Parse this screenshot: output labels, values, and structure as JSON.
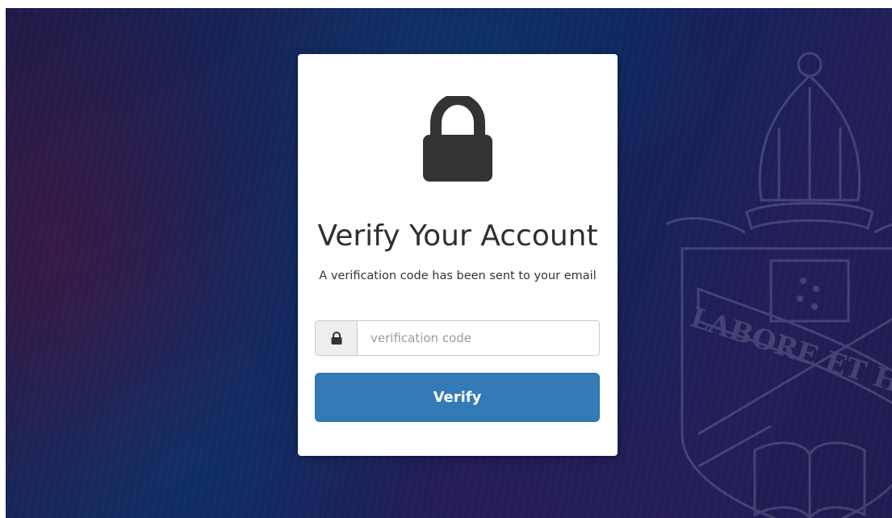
{
  "card": {
    "icon": "lock-icon",
    "title": "Verify Your Account",
    "subtitle": "A verification code has been sent to your email"
  },
  "form": {
    "addon_icon": "lock-icon",
    "code_placeholder": "verification code",
    "code_value": "",
    "verify_label": "Verify"
  },
  "background": {
    "crest_motto": "LABORE ET HO"
  },
  "colors": {
    "button": "#337ab7",
    "background_dark": "#13285e",
    "card": "#ffffff",
    "lock": "#333333"
  }
}
